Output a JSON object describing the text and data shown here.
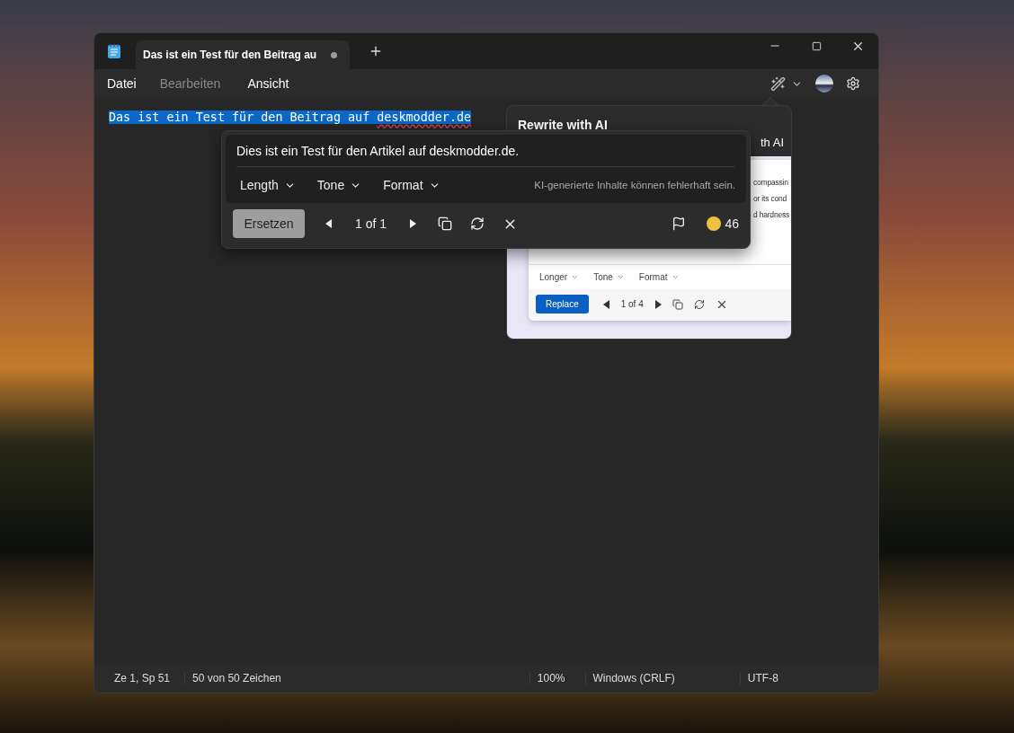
{
  "tabs": [
    {
      "label": "Das ist ein Test für den Beitrag au",
      "selected": true,
      "unsaved": true
    }
  ],
  "menu": [
    {
      "label": "Datei",
      "disabled": false
    },
    {
      "label": "Bearbeiten",
      "disabled": true
    },
    {
      "label": "Ansicht",
      "disabled": false
    }
  ],
  "editor": {
    "selected": true,
    "segments": [
      {
        "text": "Das ist ein Test für den Beitrag auf ",
        "misspelled": false
      },
      {
        "text": "deskmodder.de",
        "misspelled": true
      }
    ]
  },
  "rewrite_popup": {
    "result": "Dies ist ein Test für den Artikel auf deskmodder.de.",
    "options": [
      "Length",
      "Tone",
      "Format"
    ],
    "disclaimer": "KI-generierte Inhalte können fehlerhaft sein.",
    "replace_button": "Ersetzen",
    "counter": "1 of 1",
    "credits": "46"
  },
  "teaching_tip": {
    "title": "Rewrite with AI",
    "title_fragment": "th AI",
    "preview": {
      "lines": [
        "compassin",
        "or its cond",
        "d hardness"
      ],
      "options": [
        "Longer",
        "Tone",
        "Format"
      ],
      "button": "Replace",
      "counter": "1 of 4"
    }
  },
  "status_bar": [
    {
      "text": "Ze 1, Sp 51"
    },
    {
      "text": "50 von 50 Zeichen"
    },
    {
      "text": "100%"
    },
    {
      "text": "Windows (CRLF)"
    },
    {
      "text": "UTF-8"
    }
  ]
}
